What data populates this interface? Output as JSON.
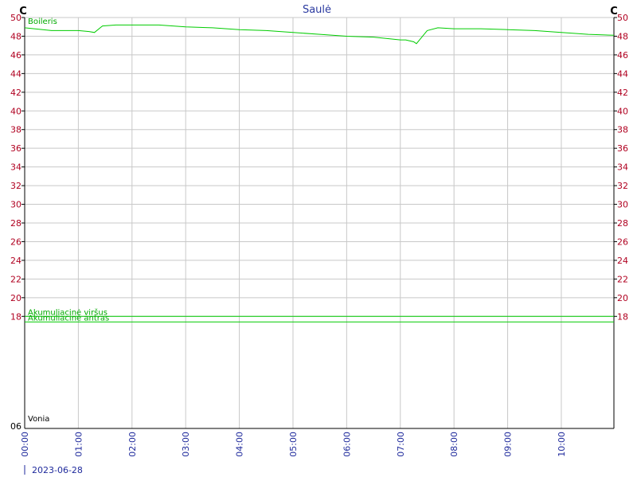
{
  "chart_data": {
    "type": "line",
    "title": "Saulė",
    "y_unit_left": "C",
    "y_unit_right": "C",
    "ylim": [
      6,
      50
    ],
    "y_ticks": [
      "18",
      "20",
      "22",
      "24",
      "26",
      "28",
      "30",
      "32",
      "34",
      "36",
      "38",
      "40",
      "42",
      "44",
      "46",
      "48",
      "50"
    ],
    "y_bottom_label": "06",
    "x_ticks": [
      "00:00",
      "01:00",
      "02:00",
      "03:00",
      "04:00",
      "05:00",
      "06:00",
      "07:00",
      "08:00",
      "09:00",
      "10:00"
    ],
    "x_range_hours": [
      0,
      10.98
    ],
    "date_label": "2023-06-28",
    "grid": true,
    "series": [
      {
        "name": "Boileris",
        "color": "#00cc00",
        "x": [
          0,
          0.5,
          1.0,
          1.2,
          1.3,
          1.45,
          1.7,
          2.0,
          2.5,
          3.0,
          3.5,
          4.0,
          4.5,
          5.0,
          5.5,
          6.0,
          6.5,
          7.0,
          7.1,
          7.25,
          7.3,
          7.5,
          7.7,
          8.0,
          8.5,
          9.0,
          9.5,
          10.0,
          10.5,
          10.98
        ],
        "y": [
          48.9,
          48.6,
          48.6,
          48.5,
          48.4,
          49.1,
          49.2,
          49.2,
          49.2,
          49.0,
          48.9,
          48.7,
          48.6,
          48.4,
          48.2,
          48.0,
          47.9,
          47.6,
          47.6,
          47.4,
          47.2,
          48.6,
          48.9,
          48.8,
          48.8,
          48.7,
          48.6,
          48.4,
          48.2,
          48.1
        ]
      },
      {
        "name": "Akumuliacinė viršus",
        "color": "#00cc00",
        "x": [
          0,
          2,
          4,
          6,
          8,
          10,
          10.98
        ],
        "y": [
          18.0,
          18.0,
          18.0,
          18.0,
          18.0,
          18.0,
          18.0
        ]
      },
      {
        "name": "Akumuliacinė antras",
        "color": "#00cc00",
        "x": [
          0,
          2,
          4,
          6,
          8,
          10,
          10.98
        ],
        "y": [
          17.4,
          17.4,
          17.4,
          17.4,
          17.4,
          17.4,
          17.4
        ]
      },
      {
        "name": "Vonia",
        "color": "#000000",
        "x": [],
        "y": []
      }
    ]
  }
}
